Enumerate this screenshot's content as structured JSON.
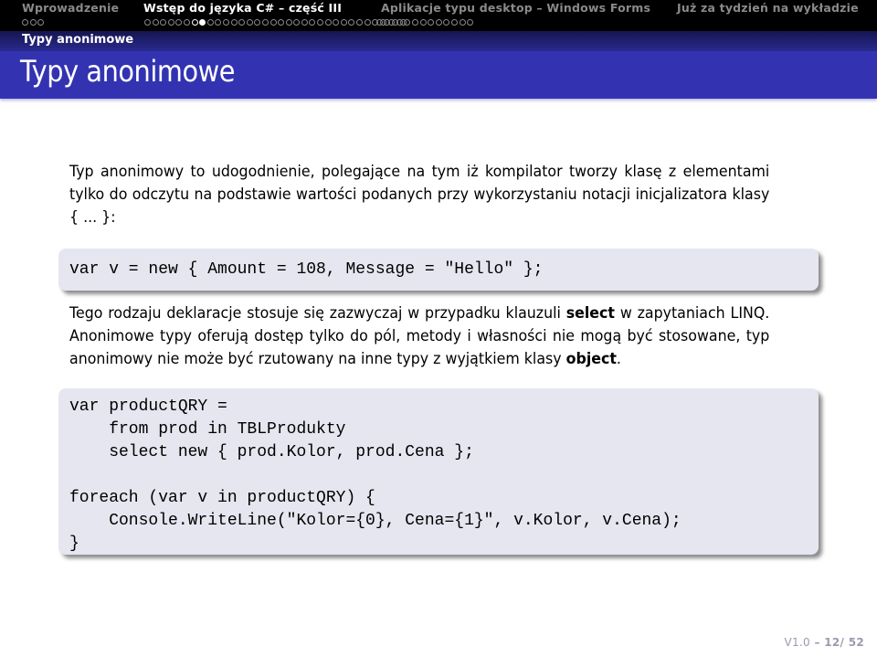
{
  "navigation": {
    "sections": [
      {
        "label": "Wprowadzenie",
        "active": false,
        "dots": "ooo"
      },
      {
        "label": "Wstęp do języka C# – część III",
        "active": true,
        "dots": "ooooooCFooooooooooooooooooooottttttttooooooooo"
      },
      {
        "label": "Aplikacje typu desktop – Windows Forms",
        "active": false
      },
      {
        "label": "Już za tydzień na wykładzie",
        "active": false
      }
    ],
    "subsection": "Typy anonimowe"
  },
  "frame": {
    "title": "Typy anonimowe",
    "intro": "Typ anonimowy to udogodnienie, polegające na tym iż kompilator tworzy klasę z elementami tylko do odczytu na podstawie wartości podanych przy wykorzystaniu notacji inicjalizatora klasy { ... }:",
    "code1": [
      "var v = new { Amount = 108, Message = \"Hello\" };"
    ],
    "para2": {
      "t1": "Tego rodzaju deklaracje stosuje się zazwyczaj w przypadku klauzuli ",
      "b1": "select",
      "t2": " w zapytaniach LINQ. Anonimowe typy oferują dostęp tylko do pól, metody i własności nie mogą być stosowane, typ anonimowy nie może być rzutowany na inne typy z wyjątkiem klasy ",
      "b2": "object",
      "t3": "."
    },
    "code2": [
      "var productQRY =",
      "    from prod in TBLProdukty",
      "    select new { prod.Kolor, prod.Cena };",
      "",
      "foreach (var v in productQRY) {",
      "    Console.WriteLine(\"Kolor={0}, Cena={1}\", v.Kolor, v.Cena);",
      "}"
    ]
  },
  "footer": {
    "version": "V1.0",
    "separator": " – ",
    "page": "12/ 52"
  },
  "colors": {
    "navbar": "#000000",
    "title_bar": "#3333b2",
    "code_bg": "#e6e6f0",
    "footer_text": "#9a9ab0"
  }
}
